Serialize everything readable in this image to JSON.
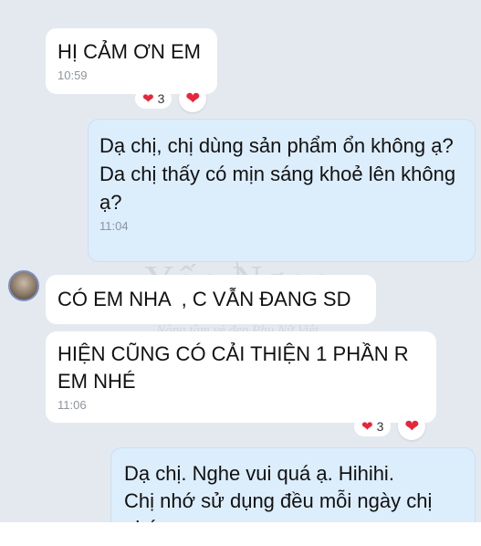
{
  "watermark": {
    "brand": "Yến Ngọc",
    "sub": "BEAUTY",
    "tagline": "Nâng tầm vẻ đẹp Phụ Nữ Việt",
    "small": "Yến Ngọc Beauty"
  },
  "messages": [
    {
      "text": "HỊ CẢM ƠN EM",
      "time": "10:59",
      "reaction_count": "3"
    },
    {
      "text": "Dạ chị, chị dùng sản phẩm ổn không ạ?\nDa chị thấy có mịn sáng khoẻ lên không ạ?",
      "time": "11:04"
    },
    {
      "text": "CÓ EM NHA  , C VẪN ĐANG SD"
    },
    {
      "text": "HIỆN CŨNG CÓ CẢI THIỆN 1 PHẦN R EM NHÉ",
      "time": "11:06",
      "reaction_count": "3"
    },
    {
      "text": "Dạ chị. Nghe vui quá ạ. Hihihi.\nChị nhớ sử dụng đều mỗi ngày chị nhé"
    }
  ],
  "colors": {
    "heart": "#e8253a",
    "outgoing_bubble": "#dcedfc",
    "background": "#e4e9f0"
  }
}
